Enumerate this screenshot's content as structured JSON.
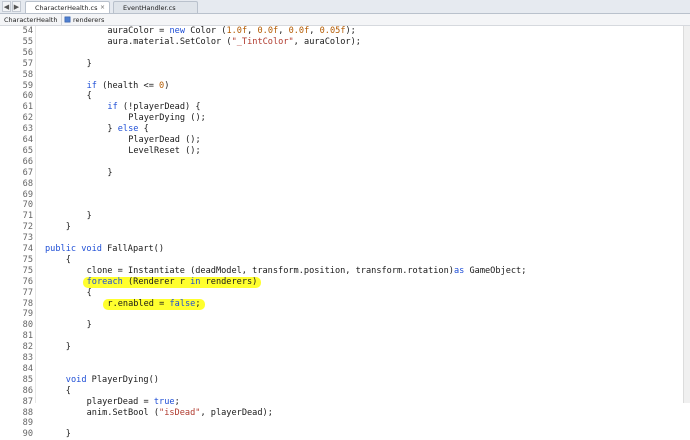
{
  "tabs": [
    {
      "label": "CharacterHealth.cs",
      "active": true
    },
    {
      "label": "EventHandler.cs",
      "active": false
    }
  ],
  "breadcrumb": {
    "class_name": "CharacterHealth",
    "member_name": "renderers"
  },
  "icons": {
    "nav_left": "◀",
    "nav_right": "▶",
    "close": "×",
    "class_icon": "class-icon",
    "field_icon": "field-icon"
  },
  "highlight_color": "#ffff2e",
  "lines": [
    {
      "num": "54",
      "indent": 12,
      "parts": [
        [
          "t",
          "aura"
        ],
        [
          "t",
          "Color = "
        ],
        [
          "kw",
          "new"
        ],
        [
          "t",
          " Color ("
        ],
        [
          "num",
          "1.0f"
        ],
        [
          "t",
          ", "
        ],
        [
          "num",
          "0.0f"
        ],
        [
          "t",
          ", "
        ],
        [
          "num",
          "0.0f"
        ],
        [
          "t",
          ", "
        ],
        [
          "num",
          "0.05f"
        ],
        [
          "t",
          ");"
        ]
      ]
    },
    {
      "num": "55",
      "indent": 12,
      "parts": [
        [
          "t",
          "aura.material.SetColor ("
        ],
        [
          "str",
          "\"_TintColor\""
        ],
        [
          "t",
          ", auraColor);"
        ]
      ]
    },
    {
      "num": "56",
      "indent": 0,
      "parts": []
    },
    {
      "num": "57",
      "indent": 8,
      "parts": [
        [
          "t",
          "}"
        ]
      ]
    },
    {
      "num": "58",
      "indent": 0,
      "parts": []
    },
    {
      "num": "59",
      "indent": 8,
      "parts": [
        [
          "kw",
          "if"
        ],
        [
          "t",
          " (health <= "
        ],
        [
          "num",
          "0"
        ],
        [
          "t",
          ")"
        ]
      ]
    },
    {
      "num": "60",
      "indent": 8,
      "parts": [
        [
          "t",
          "{"
        ]
      ]
    },
    {
      "num": "61",
      "indent": 12,
      "parts": [
        [
          "kw",
          "if"
        ],
        [
          "t",
          " (!playerDead) {"
        ]
      ]
    },
    {
      "num": "62",
      "indent": 16,
      "parts": [
        [
          "t",
          "PlayerDying ();"
        ]
      ]
    },
    {
      "num": "63",
      "indent": 12,
      "parts": [
        [
          "t",
          "} "
        ],
        [
          "kw",
          "else"
        ],
        [
          "t",
          " {"
        ]
      ]
    },
    {
      "num": "64",
      "indent": 16,
      "parts": [
        [
          "t",
          "PlayerDead ();"
        ]
      ]
    },
    {
      "num": "65",
      "indent": 16,
      "parts": [
        [
          "t",
          "LevelReset ();"
        ]
      ]
    },
    {
      "num": "66",
      "indent": 0,
      "parts": []
    },
    {
      "num": "67",
      "indent": 12,
      "parts": [
        [
          "t",
          "}"
        ]
      ]
    },
    {
      "num": "68",
      "indent": 0,
      "parts": []
    },
    {
      "num": "69",
      "indent": 0,
      "parts": []
    },
    {
      "num": "70",
      "indent": 0,
      "parts": []
    },
    {
      "num": "71",
      "indent": 8,
      "parts": [
        [
          "t",
          "}"
        ]
      ]
    },
    {
      "num": "72",
      "indent": 4,
      "parts": [
        [
          "t",
          "}"
        ]
      ]
    },
    {
      "num": "73",
      "indent": 0,
      "parts": []
    },
    {
      "num": "74",
      "indent": 0,
      "parts": [
        [
          "kw",
          "public"
        ],
        [
          "t",
          " "
        ],
        [
          "kw",
          "void"
        ],
        [
          "t",
          " FallApart()"
        ]
      ]
    },
    {
      "num": "75",
      "indent": 4,
      "parts": [
        [
          "t",
          "{"
        ]
      ]
    },
    {
      "num": "75",
      "indent": 8,
      "parts": [
        [
          "t",
          "clone = Instantiate (deadModel, transform.position, transform.rotation)"
        ],
        [
          "kw",
          "as"
        ],
        [
          "t",
          " GameObject;"
        ]
      ]
    },
    {
      "num": "76",
      "indent": 8,
      "highlight": true,
      "parts": [
        [
          "kw",
          "foreach"
        ],
        [
          "t",
          " (Renderer r "
        ],
        [
          "kw",
          "in"
        ],
        [
          "t",
          " renderers)"
        ]
      ]
    },
    {
      "num": "77",
      "indent": 8,
      "parts": [
        [
          "t",
          "{"
        ]
      ]
    },
    {
      "num": "78",
      "indent": 12,
      "highlight": true,
      "parts": [
        [
          "t",
          "r.enabled = "
        ],
        [
          "kw",
          "false"
        ],
        [
          "t",
          ";"
        ]
      ]
    },
    {
      "num": "79",
      "indent": 0,
      "parts": []
    },
    {
      "num": "80",
      "indent": 8,
      "parts": [
        [
          "t",
          "}"
        ]
      ]
    },
    {
      "num": "81",
      "indent": 0,
      "parts": []
    },
    {
      "num": "82",
      "indent": 4,
      "parts": [
        [
          "t",
          "}"
        ]
      ]
    },
    {
      "num": "83",
      "indent": 0,
      "parts": []
    },
    {
      "num": "84",
      "indent": 0,
      "parts": []
    },
    {
      "num": "85",
      "indent": 4,
      "parts": [
        [
          "kw",
          "void"
        ],
        [
          "t",
          " PlayerDying()"
        ]
      ]
    },
    {
      "num": "86",
      "indent": 4,
      "parts": [
        [
          "t",
          "{"
        ]
      ]
    },
    {
      "num": "87",
      "indent": 8,
      "parts": [
        [
          "t",
          "playerDead = "
        ],
        [
          "kw",
          "true"
        ],
        [
          "t",
          ";"
        ]
      ]
    },
    {
      "num": "88",
      "indent": 8,
      "parts": [
        [
          "t",
          "anim.SetBool ("
        ],
        [
          "str",
          "\"isDead\""
        ],
        [
          "t",
          ", playerDead);"
        ]
      ]
    },
    {
      "num": "89",
      "indent": 0,
      "parts": []
    },
    {
      "num": "90",
      "indent": 4,
      "parts": [
        [
          "t",
          "}"
        ]
      ]
    }
  ]
}
